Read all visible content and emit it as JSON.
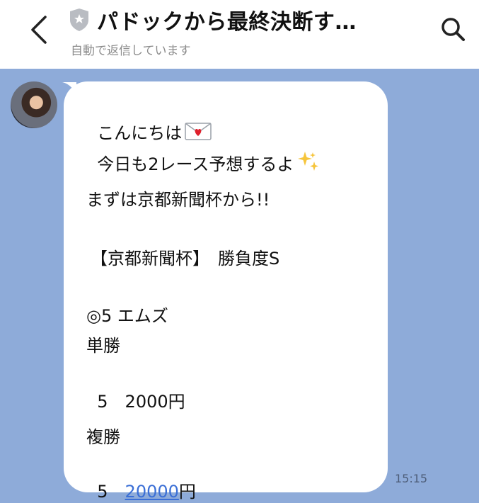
{
  "header": {
    "title": "パドックから最終決断す…",
    "subtitle": "自動で返信しています"
  },
  "message": {
    "lines": {
      "greeting": "こんにちは",
      "today": "今日も2レース予想するよ",
      "first_race": "まずは京都新聞杯から!!",
      "race_header": "【京都新聞杯】　勝負度S",
      "pick": "◎5 エムズ",
      "win_label": "単勝",
      "win_number": "5",
      "win_amount": "2000円",
      "place_label": "複勝",
      "place_number": "5",
      "place_amount_link": "20000",
      "place_amount_unit": "円"
    },
    "time": "15:15"
  },
  "colors": {
    "chat_background": "#8eabd9",
    "link": "#3b6fd6"
  }
}
